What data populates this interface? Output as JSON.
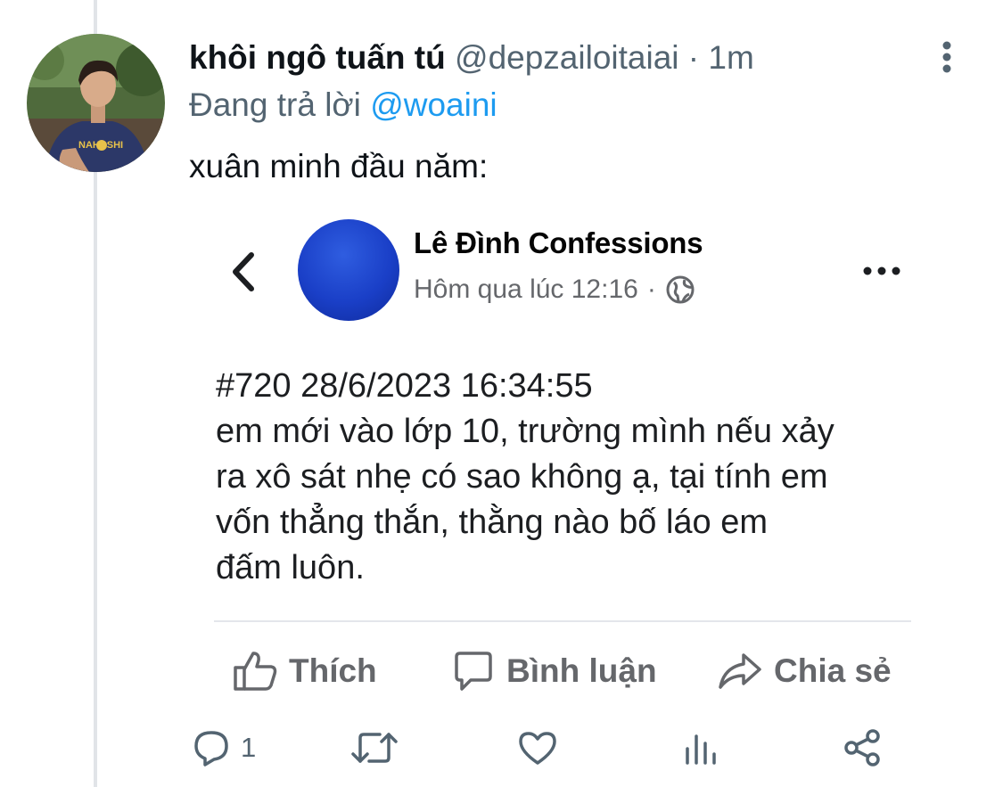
{
  "tweet": {
    "display_name": "khôi ngô tuấn tú",
    "handle": "@depzailoitaiai",
    "separator": "·",
    "time": "1m",
    "reply_prefix": "Đang trả lời",
    "reply_mention": "@woaini",
    "text": "xuân minh đầu năm:",
    "reply_count": "1"
  },
  "embed": {
    "page_name": "Lê Đình Confessions",
    "time": "Hôm qua lúc 12:16",
    "time_separator": "·",
    "post_lines": [
      "#720 28/6/2023  16:34:55",
      "em mới vào lớp 10, trường mình nếu xảy",
      "ra xô sát nhẹ có sao không ạ, tại tính em",
      "vốn thẳng thắn, thằng nào bố láo em",
      "đấm luôn."
    ],
    "actions": {
      "like": "Thích",
      "comment": "Bình luận",
      "share": "Chia sẻ"
    },
    "avatar_color": "#1a3fc7"
  },
  "colors": {
    "accent": "#1d9bf0",
    "secondary_text": "#536471",
    "thread_line": "#e1e4e8"
  },
  "icons": {
    "reply": "reply-icon",
    "retweet": "retweet-icon",
    "like": "heart-icon",
    "analytics": "analytics-icon",
    "share": "share-icon",
    "more": "more-vertical-icon"
  }
}
